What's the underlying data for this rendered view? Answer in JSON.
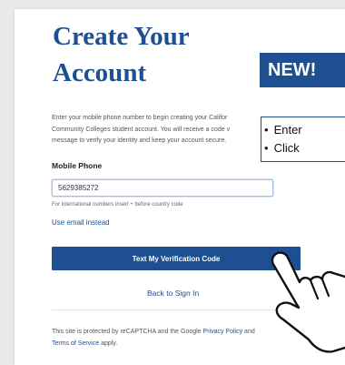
{
  "form": {
    "title_line1": "Create Your",
    "title_line2": "Account",
    "intro_lines": [
      "Enter your mobile phone number to begin creating your Califor",
      "Community Colleges student account. You will receive a code v",
      "message to verify your identity and keep your account secure."
    ],
    "mobile_label": "Mobile Phone",
    "phone_value": "5629385272",
    "phone_hint": "For international numbers insert + before country code",
    "use_email_link": "Use email instead",
    "verify_button": "Text My Verification Code",
    "back_link": "Back to Sign In",
    "footer": {
      "text1": "This site is protected by reCAPTCHA and the Google ",
      "privacy_link": "Privacy Policy",
      "text2": " and ",
      "terms_link": "Terms of Service",
      "text3": " apply."
    }
  },
  "overlay": {
    "new_badge": "NEW!",
    "callout_items": [
      "Enter",
      "Click"
    ],
    "bullet": "•",
    "pointer_icon": "pointing-hand-icon"
  },
  "colors": {
    "brand_blue": "#1d4f91",
    "page_bg": "#eaeaea",
    "card_bg": "#ffffff"
  }
}
